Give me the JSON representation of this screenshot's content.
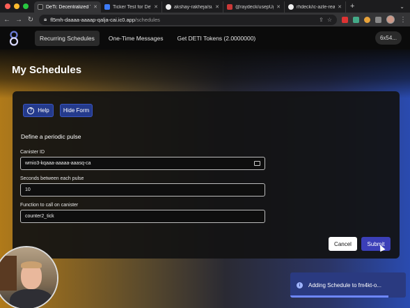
{
  "browser": {
    "tabs": [
      {
        "title": "DeTi: Decentralized T",
        "active": true,
        "favicon": "deti-logo-icon"
      },
      {
        "title": "Ticker Test for DeTi",
        "active": false,
        "favicon": "document-icon"
      },
      {
        "title": "akshay-rakheja/supe",
        "active": false,
        "favicon": "github-icon"
      },
      {
        "title": "@raydeck/usepUg -",
        "active": false,
        "favicon": "npm-icon"
      },
      {
        "title": "rhdeck/ic-azle-react",
        "active": false,
        "favicon": "github-icon"
      }
    ],
    "new_tab_label": "+",
    "url_host": "fl5mh-daaaa-aaaap-qalja-cai.ic0.app",
    "url_path": "/schedules"
  },
  "app": {
    "nav": [
      {
        "label": "Recurring Schedules",
        "active": true
      },
      {
        "label": "One-Time Messages",
        "active": false
      },
      {
        "label": "Get DETI Tokens (2.0000000)",
        "active": false
      }
    ],
    "principal": "6x54...",
    "page_title": "My Schedules"
  },
  "form": {
    "help_label": "Help",
    "hide_form_label": "Hide Form",
    "section_title": "Define a periodic pulse",
    "canister_label": "Canister ID",
    "canister_value": "wmio3-kqaaa-aaaaa-aaasq-ca",
    "seconds_label": "Seconds between each pulse",
    "seconds_value": "10",
    "function_label": "Function to call on canister",
    "function_value": "counter2_tick",
    "cancel_label": "Cancel",
    "submit_label": "Submit"
  },
  "toast": {
    "message": "Adding Schedule to fm4kt-o...",
    "progress": 0.85
  },
  "colors": {
    "accent": "#243a8c",
    "submit": "#3b3fb8",
    "toast": "#2a3a80"
  }
}
